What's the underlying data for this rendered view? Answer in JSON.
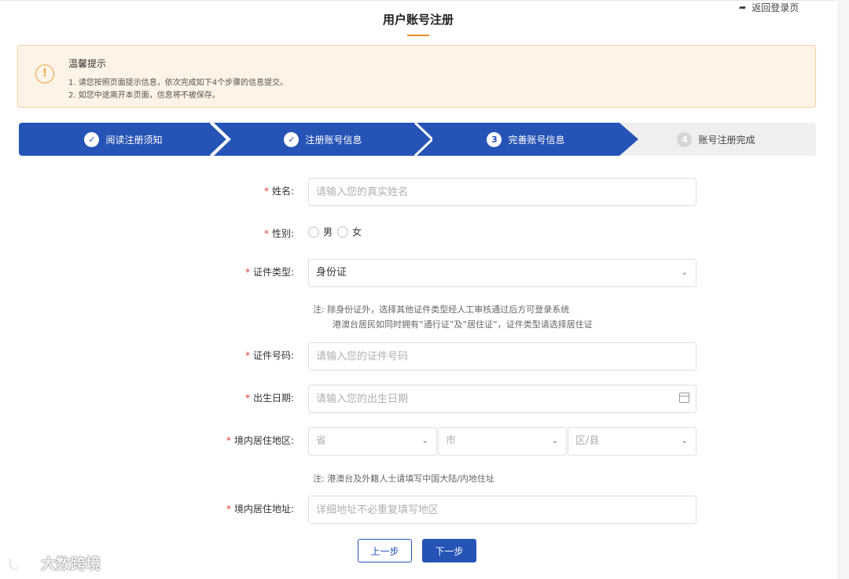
{
  "header": {
    "title": "用户账号注册",
    "back_link": "返回登录页",
    "back_icon": "arrow-icon"
  },
  "notice": {
    "icon": "warning-circle-icon",
    "title": "温馨提示",
    "lines": [
      "1. 请您按照页面提示信息，依次完成如下4个步骤的信息提交。",
      "2. 如您中途离开本页面，信息将不被保存。"
    ]
  },
  "steps": [
    {
      "label": "阅读注册须知",
      "marker": "✓",
      "state": "done"
    },
    {
      "label": "注册账号信息",
      "marker": "✓",
      "state": "done"
    },
    {
      "label": "完善账号信息",
      "marker": "3",
      "state": "active"
    },
    {
      "label": "账号注册完成",
      "marker": "4",
      "state": "pending"
    }
  ],
  "colors": {
    "primary": "#2653b6",
    "accent": "#f08c28",
    "required": "#e2392f",
    "notice_bg": "#fdf3e6"
  },
  "form": {
    "required_mark": "*",
    "name": {
      "label": "姓名:",
      "placeholder": "请输入您的真实姓名"
    },
    "gender": {
      "label": "性别:",
      "options": [
        "男",
        "女"
      ]
    },
    "id_type": {
      "label": "证件类型:",
      "value": "身份证",
      "note_lines": [
        "注: 除身份证外，选择其他证件类型经人工审核通过后方可登录系统",
        "港澳台居民如同时拥有“通行证”及“居住证”，证件类型请选择居住证"
      ]
    },
    "id_number": {
      "label": "证件号码:",
      "placeholder": "请输入您的证件号码"
    },
    "birth_date": {
      "label": "出生日期:",
      "placeholder": "请输入您的出生日期"
    },
    "region": {
      "label": "境内居住地区:",
      "province_placeholder": "省",
      "city_placeholder": "市",
      "district_placeholder": "区/县",
      "note": "注: 港澳台及外籍人士请填写中国大陆/内地住址"
    },
    "address": {
      "label": "境内居住地址:",
      "placeholder": "详细地址不必重复填写地区"
    }
  },
  "buttons": {
    "prev": "上一步",
    "next": "下一步"
  },
  "watermark": {
    "text": "大数跨境"
  }
}
